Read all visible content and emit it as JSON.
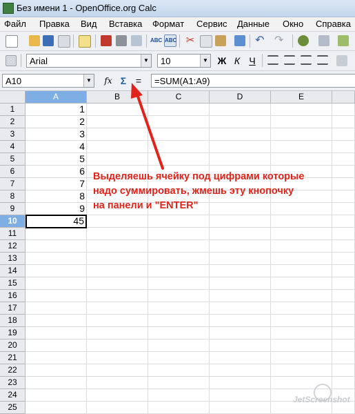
{
  "window": {
    "title": "Без имени 1 - OpenOffice.org Calc"
  },
  "menu": [
    "Файл",
    "Правка",
    "Вид",
    "Вставка",
    "Формат",
    "Сервис",
    "Данные",
    "Окно",
    "Справка"
  ],
  "toolbar_icons": [
    "new-icon",
    "open-icon",
    "save-icon",
    "email-icon",
    "edit-icon",
    "export-pdf-icon",
    "print-icon",
    "print-preview-icon",
    "spellcheck-icon",
    "autospellcheck-icon",
    "cut-icon",
    "copy-icon",
    "paste-icon",
    "format-paintbrush-icon",
    "undo-icon",
    "redo-icon",
    "hyperlink-icon"
  ],
  "formatting": {
    "font_name": "Arial",
    "font_size": "10",
    "bold": "Ж",
    "italic": "К",
    "underline": "Ч"
  },
  "formula_bar": {
    "cell_ref": "A10",
    "function_wizard": "fx",
    "sum": "Σ",
    "equals": "=",
    "formula": "=SUM(A1:A9)"
  },
  "grid": {
    "columns": [
      "A",
      "B",
      "C",
      "D",
      "E"
    ],
    "rows": [
      "1",
      "2",
      "3",
      "4",
      "5",
      "6",
      "7",
      "8",
      "9",
      "10",
      "11",
      "12",
      "13",
      "14",
      "15",
      "16",
      "17",
      "18",
      "19",
      "20",
      "21",
      "22",
      "23",
      "24",
      "25"
    ],
    "active_cell": "A10",
    "values": {
      "A1": "1",
      "A2": "2",
      "A3": "3",
      "A4": "4",
      "A5": "5",
      "A6": "6",
      "A7": "7",
      "A8": "8",
      "A9": "9",
      "A10": "45"
    }
  },
  "annotation": {
    "lines": [
      "Выделяешь ячейку под цифрами которые",
      "надо суммировать, жмешь эту кнопочку",
      "на панели и \"ENTER\""
    ],
    "color": "#e2231a"
  },
  "watermark": "JetScreenshot"
}
